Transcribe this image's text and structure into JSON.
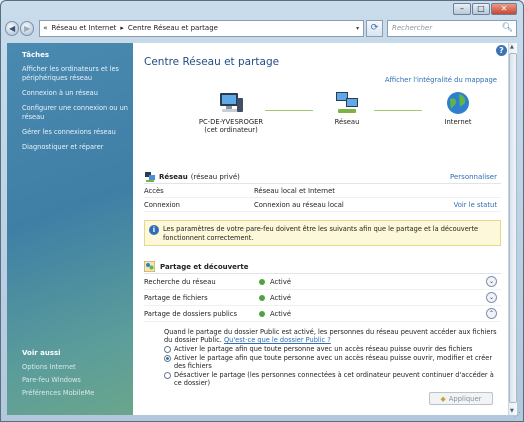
{
  "window": {
    "min": "–",
    "max": "□",
    "close": "✕"
  },
  "addressbar": {
    "back": "◀",
    "forward": "▶",
    "crumbs": [
      "«",
      "Réseau et Internet",
      "▸",
      "Centre Réseau et partage"
    ],
    "dropdown": "▾",
    "refresh": "⟳",
    "search_placeholder": "Rechercher"
  },
  "sidebar": {
    "title": "Tâches",
    "items": [
      "Afficher les ordinateurs et les périphériques réseau",
      "Connexion à un réseau",
      "Configurer une connexion ou un réseau",
      "Gérer les connexions réseau",
      "Diagnostiquer et réparer"
    ],
    "see_also_title": "Voir aussi",
    "see_also": [
      "Options Internet",
      "Pare-feu Windows",
      "Préférences MobileMe"
    ]
  },
  "main": {
    "title": "Centre Réseau et partage",
    "full_map_link": "Afficher l'intégralité du mappage",
    "map_nodes": [
      {
        "label": "PC-DE-YVESROGER",
        "sub": "(cet ordinateur)"
      },
      {
        "label": "Réseau",
        "sub": ""
      },
      {
        "label": "Internet",
        "sub": ""
      }
    ],
    "network": {
      "name": "Réseau",
      "type": "(réseau privé)",
      "customize": "Personnaliser",
      "rows": [
        {
          "key": "Accès",
          "value": "Réseau local et Internet",
          "link": ""
        },
        {
          "key": "Connexion",
          "value": "Connexion au réseau local",
          "link": "Voir le statut"
        }
      ]
    },
    "firewall_note": "Les paramètres de votre pare-feu doivent être les suivants afin que le partage et la découverte fonctionnent correctement.",
    "sharing": {
      "title": "Partage et découverte",
      "rows": [
        {
          "key": "Recherche du réseau",
          "status": "Activé",
          "chevron": "⌄"
        },
        {
          "key": "Partage de fichiers",
          "status": "Activé",
          "chevron": "⌄"
        },
        {
          "key": "Partage de dossiers publics",
          "status": "Activé",
          "chevron": "⌃"
        }
      ],
      "public_desc": "Quand le partage du dossier Public est activé, les personnes du réseau peuvent accéder aux fichiers du dossier Public.",
      "public_link": "Qu'est-ce que le dossier Public ?",
      "options": [
        {
          "label": "Activer le partage afin que toute personne avec un accès réseau puisse ouvrir des fichiers",
          "selected": false
        },
        {
          "label": "Activer le partage afin que toute personne avec un accès réseau puisse ouvrir, modifier et créer des fichiers",
          "selected": true
        },
        {
          "label": "Désactiver le partage (les personnes connectées à cet ordinateur peuvent continuer d'accéder à ce dossier)",
          "selected": false
        }
      ],
      "apply": "Appliquer"
    }
  },
  "colors": {
    "accent": "#2c6db3",
    "status_green": "#4aa63c",
    "sidebar": "#3f7fa6"
  }
}
